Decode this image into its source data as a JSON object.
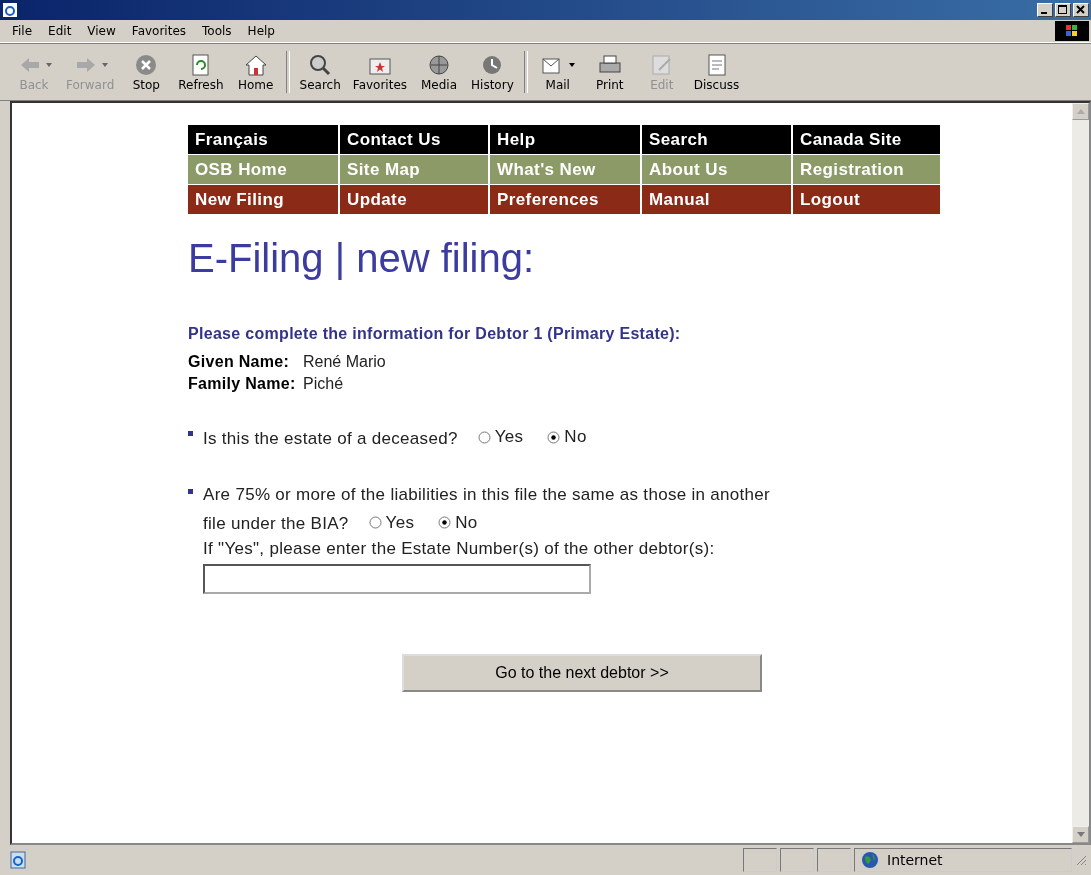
{
  "menu": [
    "File",
    "Edit",
    "View",
    "Favorites",
    "Tools",
    "Help"
  ],
  "toolbar": [
    {
      "label": "Back",
      "kind": "back",
      "disabled": true,
      "dropdown": true
    },
    {
      "label": "Forward",
      "kind": "forward",
      "disabled": true,
      "dropdown": true
    },
    {
      "label": "Stop",
      "kind": "stop",
      "disabled": false,
      "dropdown": false
    },
    {
      "label": "Refresh",
      "kind": "refresh",
      "disabled": false,
      "dropdown": false
    },
    {
      "label": "Home",
      "kind": "home",
      "disabled": false,
      "dropdown": false
    },
    {
      "label": "Search",
      "kind": "search",
      "disabled": false,
      "dropdown": false
    },
    {
      "label": "Favorites",
      "kind": "favorites",
      "disabled": false,
      "dropdown": false
    },
    {
      "label": "Media",
      "kind": "media",
      "disabled": false,
      "dropdown": false
    },
    {
      "label": "History",
      "kind": "history",
      "disabled": false,
      "dropdown": false
    },
    {
      "label": "Mail",
      "kind": "mail",
      "disabled": false,
      "dropdown": true
    },
    {
      "label": "Print",
      "kind": "print",
      "disabled": false,
      "dropdown": false
    },
    {
      "label": "Edit",
      "kind": "edit",
      "disabled": true,
      "dropdown": false
    },
    {
      "label": "Discuss",
      "kind": "discuss",
      "disabled": false,
      "dropdown": false
    }
  ],
  "nav": [
    {
      "color": "#000000",
      "items": [
        "Français",
        "Contact Us",
        "Help",
        "Search",
        "Canada Site"
      ]
    },
    {
      "color": "#8c9a68",
      "items": [
        "OSB Home",
        "Site Map",
        "What's New",
        "About Us",
        "Registration"
      ]
    },
    {
      "color": "#8a2a17",
      "items": [
        "New Filing",
        "Update",
        "Preferences",
        "Manual",
        "Logout"
      ]
    }
  ],
  "heading": "E-Filing | new filing:",
  "subheading": "Please complete the information for Debtor 1 (Primary Estate):",
  "fields": [
    {
      "label": "Given Name:",
      "value": "René Mario"
    },
    {
      "label": "Family Name:",
      "value": "Piché"
    }
  ],
  "questions": [
    {
      "lines": [
        "Is this the estate of a deceased?"
      ],
      "options": [
        {
          "label": "Yes",
          "selected": false
        },
        {
          "label": "No",
          "selected": true
        }
      ]
    },
    {
      "lines": [
        "Are 75% or more of the liabilities in this file the same as those in another",
        "file under the BIA?"
      ],
      "options": [
        {
          "label": "Yes",
          "selected": false
        },
        {
          "label": "No",
          "selected": true
        }
      ],
      "followup": "If \"Yes\", please enter the Estate Number(s) of the other debtor(s):"
    }
  ],
  "next_button": "Go to the next debtor >>",
  "status_bar": {
    "zone": "Internet"
  }
}
